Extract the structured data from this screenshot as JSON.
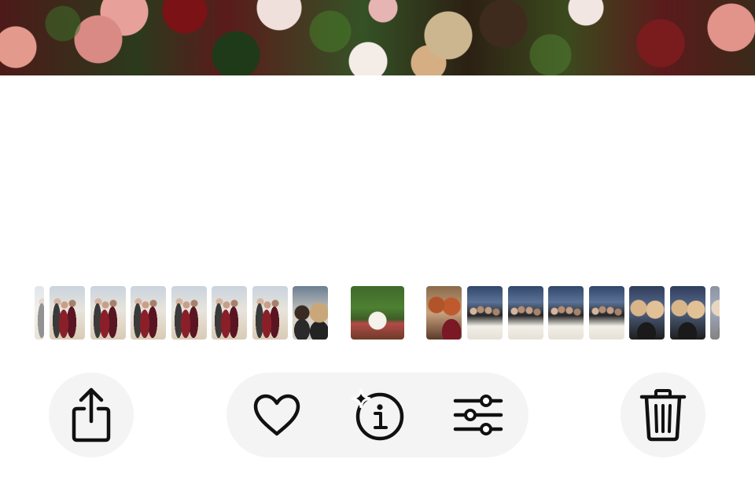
{
  "toolbar": {
    "share": {
      "icon": "share-icon",
      "label": ""
    },
    "favorite": {
      "icon": "heart-icon",
      "label": ""
    },
    "info": {
      "icon": "info-sparkle-icon",
      "label": ""
    },
    "adjust": {
      "icon": "sliders-icon",
      "label": ""
    },
    "delete": {
      "icon": "trash-icon",
      "label": ""
    }
  },
  "colors": {
    "background": "#ffffff",
    "control_fill": "#f4f4f4",
    "icon": "#111111"
  },
  "filmstrip": {
    "thumbnails": [
      {
        "kind": "couple",
        "state": "faded-edge"
      },
      {
        "kind": "couple"
      },
      {
        "kind": "couple"
      },
      {
        "kind": "couple"
      },
      {
        "kind": "couple"
      },
      {
        "kind": "couple"
      },
      {
        "kind": "couple"
      },
      {
        "kind": "selfie"
      },
      {
        "kind": "table",
        "state": "current"
      },
      {
        "kind": "redhead"
      },
      {
        "kind": "group"
      },
      {
        "kind": "group"
      },
      {
        "kind": "group"
      },
      {
        "kind": "group"
      },
      {
        "kind": "blonde"
      },
      {
        "kind": "blonde"
      },
      {
        "kind": "blonde"
      },
      {
        "kind": "blonde",
        "state": "faded-edge"
      }
    ]
  }
}
